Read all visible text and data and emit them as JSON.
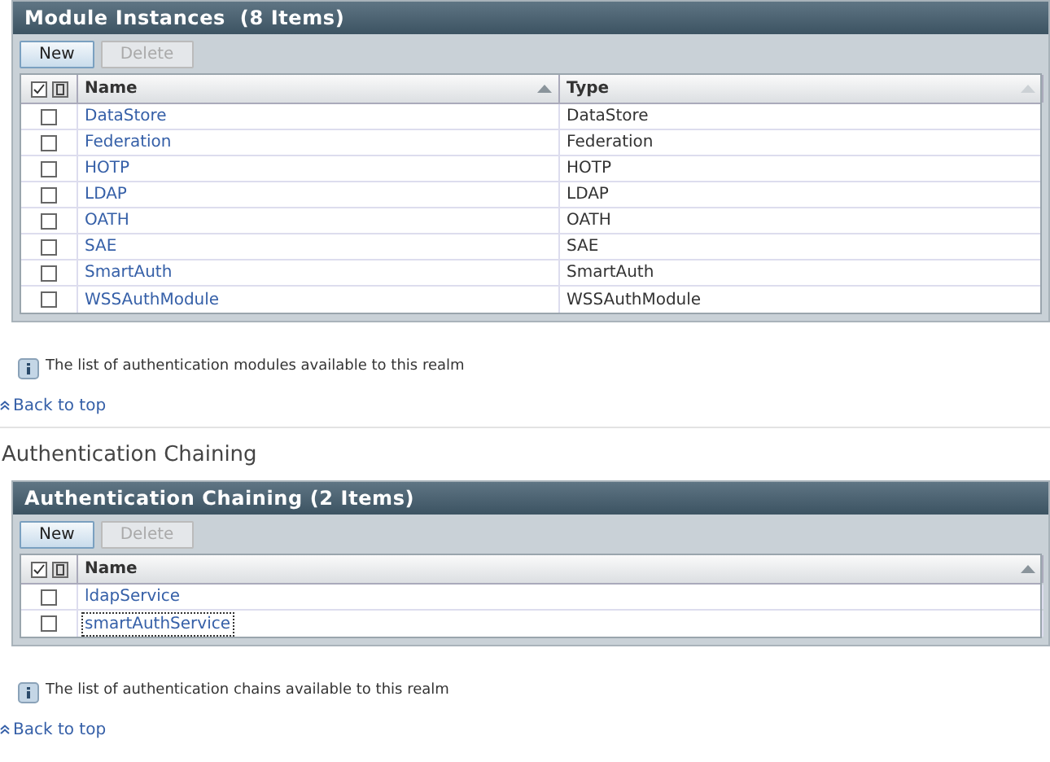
{
  "sections": [
    {
      "panel": {
        "title": "Module Instances  (8 Items)",
        "buttons": [
          {
            "label": "New",
            "disabled": false
          },
          {
            "label": "Delete",
            "disabled": true
          }
        ],
        "columns": [
          {
            "label": "Name",
            "sorted": true
          },
          {
            "label": "Type",
            "sorted": false
          }
        ],
        "rows": [
          {
            "cells": [
              "DataStore",
              "DataStore"
            ],
            "checked": false,
            "focused": false
          },
          {
            "cells": [
              "Federation",
              "Federation"
            ],
            "checked": false,
            "focused": false
          },
          {
            "cells": [
              "HOTP",
              "HOTP"
            ],
            "checked": false,
            "focused": false
          },
          {
            "cells": [
              "LDAP",
              "LDAP"
            ],
            "checked": false,
            "focused": false
          },
          {
            "cells": [
              "OATH",
              "OATH"
            ],
            "checked": false,
            "focused": false
          },
          {
            "cells": [
              "SAE",
              "SAE"
            ],
            "checked": false,
            "focused": false
          },
          {
            "cells": [
              "SmartAuth",
              "SmartAuth"
            ],
            "checked": false,
            "focused": false
          },
          {
            "cells": [
              "WSSAuthModule",
              "WSSAuthModule"
            ],
            "checked": false,
            "focused": false
          }
        ]
      },
      "info": "The list of authentication modules available to this realm",
      "back_link": "Back to top"
    },
    {
      "heading": "Authentication Chaining",
      "panel": {
        "title": "Authentication Chaining (2 Items)",
        "buttons": [
          {
            "label": "New",
            "disabled": false
          },
          {
            "label": "Delete",
            "disabled": true
          }
        ],
        "columns": [
          {
            "label": "Name",
            "sorted": true
          }
        ],
        "rows": [
          {
            "cells": [
              "ldapService"
            ],
            "checked": false,
            "focused": false
          },
          {
            "cells": [
              "smartAuthService"
            ],
            "checked": false,
            "focused": true
          }
        ]
      },
      "info": "The list of authentication chains available to this realm",
      "back_link": "Back to top"
    }
  ]
}
